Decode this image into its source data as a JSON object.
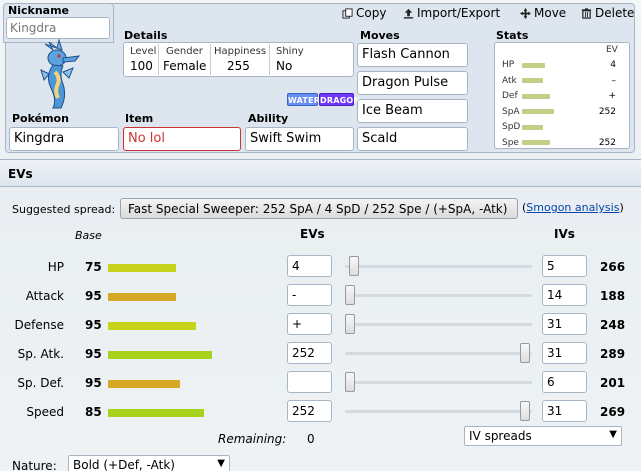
{
  "toolbar": {
    "copy_label": "Copy",
    "import_export_label": "Import/Export",
    "move_label": "Move",
    "delete_label": "Delete"
  },
  "nickname": {
    "label": "Nickname",
    "value": "Kingdra"
  },
  "details": {
    "label": "Details",
    "level_label": "Level",
    "level": "100",
    "gender_label": "Gender",
    "gender": "Female",
    "happiness_label": "Happiness",
    "happiness": "255",
    "shiny_label": "Shiny",
    "shiny": "No"
  },
  "types": [
    {
      "name": "WATER",
      "color": "#6890f0"
    },
    {
      "name": "DRAGON",
      "color": "#7038f8"
    }
  ],
  "pokemon": {
    "label": "Pokémon",
    "value": "Kingdra"
  },
  "item": {
    "label": "Item",
    "value": "No lol"
  },
  "ability": {
    "label": "Ability",
    "value": "Swift Swim"
  },
  "moves": {
    "label": "Moves",
    "list": [
      "Flash Cannon",
      "Dragon Pulse",
      "Ice Beam",
      "Scald"
    ]
  },
  "stats_panel": {
    "label": "Stats",
    "ev_header": "EV",
    "rows": [
      {
        "name": "HP",
        "ev": "4",
        "fill": 0.45
      },
      {
        "name": "Atk",
        "ev": "–",
        "fill": 0.42
      },
      {
        "name": "Def",
        "ev": "+",
        "fill": 0.55
      },
      {
        "name": "SpA",
        "ev": "252",
        "fill": 0.63
      },
      {
        "name": "SpD",
        "ev": "",
        "fill": 0.42
      },
      {
        "name": "Spe",
        "ev": "252",
        "fill": 0.56
      }
    ]
  },
  "ev_section": {
    "title": "EVs",
    "suggested_label": "Suggested spread:",
    "suggested_value": "Fast Special Sweeper: 252 SpA / 4 SpD / 252 Spe / (+SpA, -Atk)",
    "smogon_prefix": "(",
    "smogon_link": "Smogon analysis",
    "smogon_suffix": ")",
    "base_header": "Base",
    "evs_header": "EVs",
    "ivs_header": "IVs",
    "rows": [
      {
        "name": "HP",
        "base": "75",
        "bar_color": "#c7d21b",
        "bar_fill": 0.34,
        "ev": "4",
        "slider": 0.02,
        "iv": "5",
        "total": "266"
      },
      {
        "name": "Attack",
        "base": "95",
        "bar_color": "#d4a824",
        "bar_fill": 0.34,
        "ev": "-",
        "slider": 0.0,
        "iv": "14",
        "total": "188"
      },
      {
        "name": "Defense",
        "base": "95",
        "bar_color": "#c7d21b",
        "bar_fill": 0.44,
        "ev": "+",
        "slider": 0.0,
        "iv": "31",
        "total": "248"
      },
      {
        "name": "Sp. Atk.",
        "base": "95",
        "bar_color": "#a6d21b",
        "bar_fill": 0.52,
        "ev": "252",
        "slider": 0.99,
        "iv": "31",
        "total": "289"
      },
      {
        "name": "Sp. Def.",
        "base": "95",
        "bar_color": "#d4a824",
        "bar_fill": 0.36,
        "ev": "",
        "slider": 0.0,
        "iv": "6",
        "total": "201"
      },
      {
        "name": "Speed",
        "base": "85",
        "bar_color": "#a6d21b",
        "bar_fill": 0.48,
        "ev": "252",
        "slider": 0.99,
        "iv": "31",
        "total": "269"
      }
    ],
    "remaining_label": "Remaining:",
    "remaining_value": "0",
    "iv_spreads": "IV spreads",
    "nature_label": "Nature:",
    "nature_value": "Bold (+Def, -Atk)"
  }
}
